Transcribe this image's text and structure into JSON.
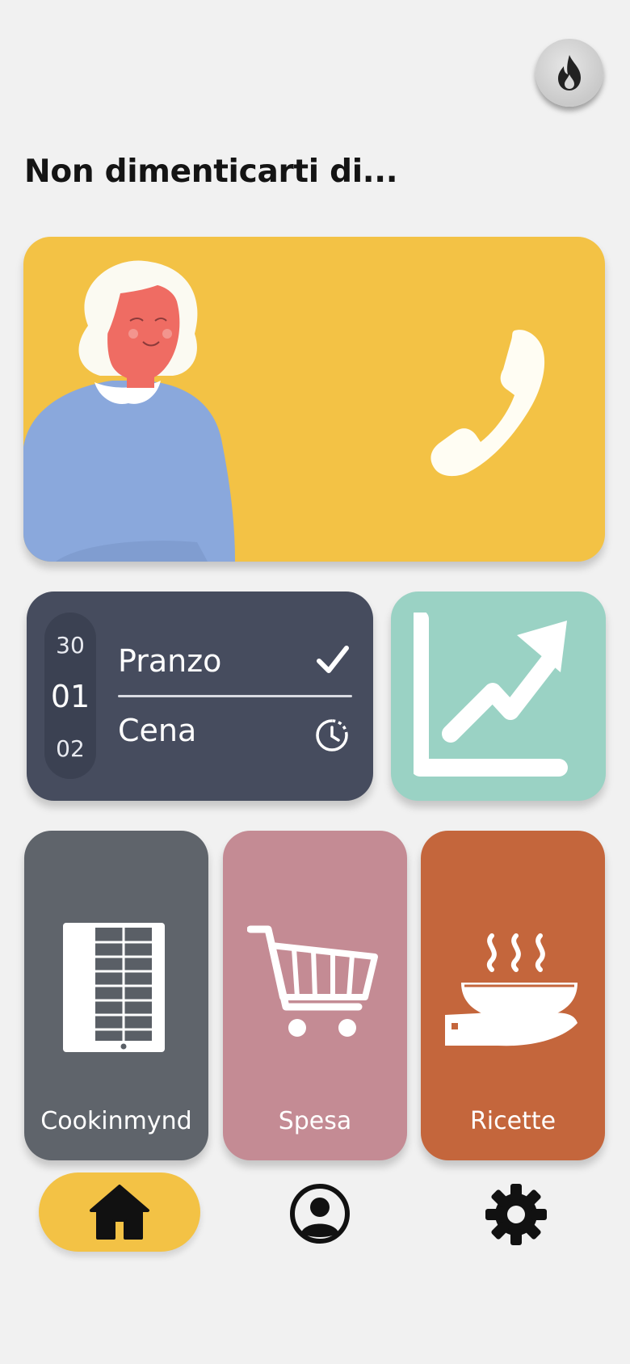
{
  "header": {
    "flame_icon": "flame-icon",
    "title": "Non dimenticarti di..."
  },
  "call_card": {
    "illustration": "grandmother-illustration",
    "icon": "phone-icon",
    "color": "#f3c245"
  },
  "meal_card": {
    "dates": [
      "30",
      "01",
      "02"
    ],
    "selected_date": "01",
    "meals": [
      {
        "label": "Pranzo",
        "status_icon": "checkmark-icon"
      },
      {
        "label": "Cena",
        "status_icon": "clock-icon"
      }
    ],
    "color": "#464c5e"
  },
  "stats_card": {
    "icon": "trending-up-chart-icon",
    "color": "#9ad2c4"
  },
  "tiles": [
    {
      "label": "Cookinmynd",
      "icon": "tablet-icon",
      "color": "#5f646b"
    },
    {
      "label": "Spesa",
      "icon": "shopping-cart-icon",
      "color": "#c48b94"
    },
    {
      "label": "Ricette",
      "icon": "serving-dish-icon",
      "color": "#c4663c"
    }
  ],
  "bottom_nav": {
    "items": [
      {
        "icon": "home-icon",
        "active": true
      },
      {
        "icon": "user-profile-icon",
        "active": false
      },
      {
        "icon": "settings-gear-icon",
        "active": false
      }
    ],
    "accent": "#f3c245"
  }
}
